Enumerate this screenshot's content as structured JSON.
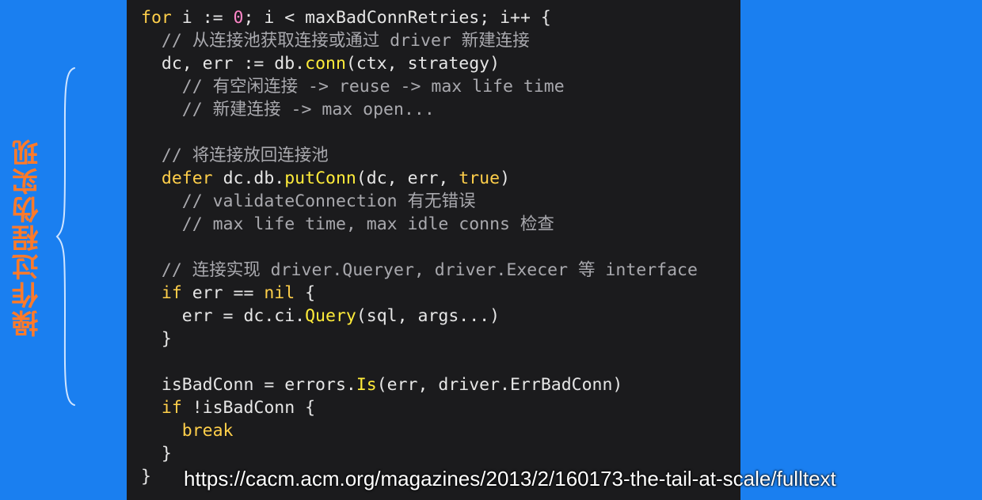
{
  "side_title": "操作过程伪实现",
  "code_lines": [
    [
      [
        "kw",
        "for"
      ],
      [
        "tx",
        " i "
      ],
      [
        "op",
        ":="
      ],
      [
        "tx",
        " "
      ],
      [
        "num",
        "0"
      ],
      [
        "tx",
        "; i "
      ],
      [
        "op",
        "<"
      ],
      [
        "tx",
        " maxBadConnRetries; i"
      ],
      [
        "op",
        "++"
      ],
      [
        "tx",
        " {"
      ]
    ],
    [
      [
        "tx",
        "  "
      ],
      [
        "cm",
        "// 从连接池获取连接或通过 driver 新建连接"
      ]
    ],
    [
      [
        "tx",
        "  dc, err "
      ],
      [
        "op",
        ":="
      ],
      [
        "tx",
        " db."
      ],
      [
        "fn",
        "conn"
      ],
      [
        "tx",
        "(ctx, strategy)"
      ]
    ],
    [
      [
        "tx",
        "    "
      ],
      [
        "cm",
        "// 有空闲连接 -> reuse -> max life time"
      ]
    ],
    [
      [
        "tx",
        "    "
      ],
      [
        "cm",
        "// 新建连接 -> max open..."
      ]
    ],
    [],
    [
      [
        "tx",
        "  "
      ],
      [
        "cm",
        "// 将连接放回连接池"
      ]
    ],
    [
      [
        "tx",
        "  "
      ],
      [
        "kw",
        "defer"
      ],
      [
        "tx",
        " dc.db."
      ],
      [
        "fn",
        "putConn"
      ],
      [
        "tx",
        "(dc, err, "
      ],
      [
        "kw",
        "true"
      ],
      [
        "tx",
        ")"
      ]
    ],
    [
      [
        "tx",
        "    "
      ],
      [
        "cm",
        "// validateConnection 有无错误"
      ]
    ],
    [
      [
        "tx",
        "    "
      ],
      [
        "cm",
        "// max life time, max idle conns 检查"
      ]
    ],
    [],
    [
      [
        "tx",
        "  "
      ],
      [
        "cm",
        "// 连接实现 driver.Queryer, driver.Execer 等 interface"
      ]
    ],
    [
      [
        "tx",
        "  "
      ],
      [
        "kw",
        "if"
      ],
      [
        "tx",
        " err "
      ],
      [
        "op",
        "=="
      ],
      [
        "tx",
        " "
      ],
      [
        "kw",
        "nil"
      ],
      [
        "tx",
        " {"
      ]
    ],
    [
      [
        "tx",
        "    err = dc.ci."
      ],
      [
        "fn",
        "Query"
      ],
      [
        "tx",
        "(sql, args...)"
      ]
    ],
    [
      [
        "tx",
        "  }"
      ]
    ],
    [],
    [
      [
        "tx",
        "  isBadConn = errors."
      ],
      [
        "fn",
        "Is"
      ],
      [
        "tx",
        "(err, driver.ErrBadConn)"
      ]
    ],
    [
      [
        "tx",
        "  "
      ],
      [
        "kw",
        "if"
      ],
      [
        "tx",
        " !isBadConn {"
      ]
    ],
    [
      [
        "tx",
        "    "
      ],
      [
        "kw",
        "break"
      ]
    ],
    [
      [
        "tx",
        "  }"
      ]
    ],
    [
      [
        "tx",
        "}"
      ]
    ]
  ],
  "footer_url": "https://cacm.acm.org/magazines/2013/2/160173-the-tail-at-scale/fulltext",
  "colors": {
    "background": "#1a7ff0",
    "code_bg": "#1b1b1d",
    "side_title": "#ff7a2a",
    "keyword": "#ffcf4a",
    "function": "#ffec3a",
    "number": "#ff86c8",
    "comment": "#a9a9ae"
  }
}
